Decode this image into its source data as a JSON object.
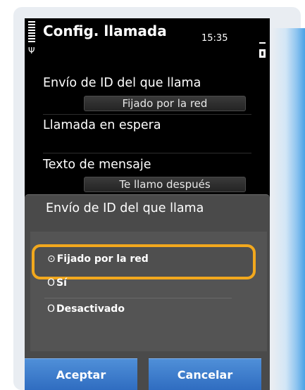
{
  "status_bar": {
    "title": "Config. llamada",
    "time": "15:35",
    "signal_icon": "signal-bars-icon",
    "antenna_icon": "antenna-icon",
    "battery_icon": "battery-icon"
  },
  "settings": [
    {
      "label": "Envío de ID del que llama",
      "value": "Fijado por la red"
    },
    {
      "label": "Llamada en espera",
      "value": ""
    },
    {
      "label": "Texto de mensaje",
      "value": "Te llamo después"
    }
  ],
  "dialog": {
    "title": "Envío de ID del que llama",
    "options": [
      {
        "label": "Fijado por la red",
        "selected": true
      },
      {
        "label": "Sí",
        "selected": false
      },
      {
        "label": "Desactivado",
        "selected": false
      }
    ],
    "radio_selected": "⊙",
    "radio_unselected": "O",
    "accept_label": "Aceptar",
    "cancel_label": "Cancelar"
  },
  "colors": {
    "highlight": "#f2a81d",
    "softkey": "#3d7dcc",
    "screen_bg": "#000000",
    "dialog_bg": "#4a4a4a"
  }
}
